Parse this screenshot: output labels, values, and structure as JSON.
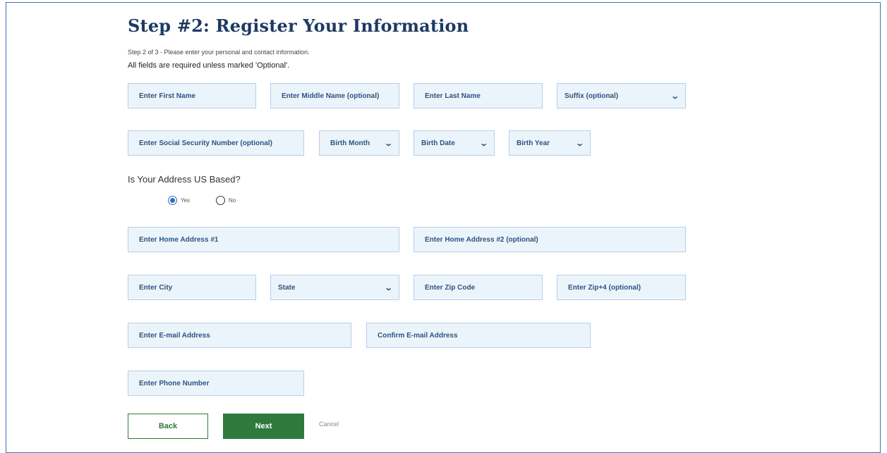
{
  "header": {
    "title": "Step #2: Register Your Information",
    "subtitle": "Step 2 of 3 - Please enter your personal and contact information.",
    "required_note": "All fields are required unless marked 'Optional'."
  },
  "fields": {
    "first_name": "Enter First Name",
    "middle_name": "Enter Middle Name (optional)",
    "last_name": "Enter Last Name",
    "suffix": "Suffix (optional)",
    "ssn": "Enter Social Security Number (optional)",
    "birth_month": "Birth Month",
    "birth_date": "Birth Date",
    "birth_year": "Birth Year",
    "home_address_1": "Enter Home Address #1",
    "home_address_2": "Enter Home Address #2 (optional)",
    "city": "Enter City",
    "state": "State",
    "zip": "Enter Zip Code",
    "zip4": "Enter Zip+4 (optional)",
    "email": "Enter E-mail Address",
    "confirm_email": "Confirm E-mail Address",
    "phone": "Enter Phone Number"
  },
  "address_question": {
    "label": "Is Your Address US Based?",
    "options": [
      {
        "label": "Yes",
        "selected": true
      },
      {
        "label": "No",
        "selected": false
      }
    ]
  },
  "actions": {
    "back": "Back",
    "next": "Next",
    "cancel": "Cancel"
  },
  "icons": {
    "select_arrow": "chevron-down-icon"
  },
  "colors": {
    "title": "#1e3a63",
    "field_bg": "#ecf4fb",
    "field_border": "#b7cfe6",
    "field_text": "#2b557f",
    "primary_green": "#2d7a3c",
    "radio_selected": "#2c6fbf"
  }
}
